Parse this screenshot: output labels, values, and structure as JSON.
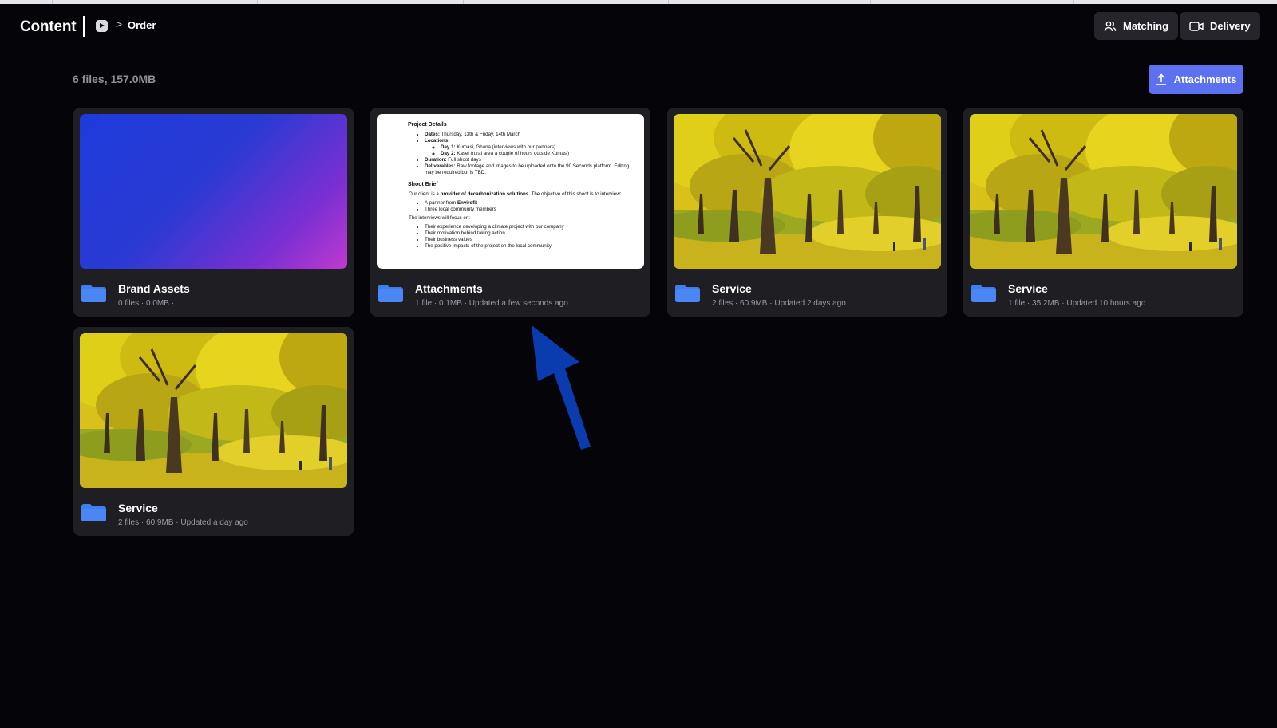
{
  "app": {
    "title": "Content"
  },
  "breadcrumb": {
    "icon": "play-badge-icon",
    "separator": ">",
    "current": "Order"
  },
  "header_buttons": [
    {
      "label": "Matching",
      "icon": "people-icon"
    },
    {
      "label": "Delivery",
      "icon": "camera-icon"
    }
  ],
  "summary": "6 files, 157.0MB",
  "upload_button": {
    "label": "Attachments",
    "icon": "upload-icon"
  },
  "cards": [
    {
      "title": "Brand Assets",
      "meta": "0 files · 0.0MB ·",
      "thumb": "gradient"
    },
    {
      "title": "Attachments",
      "meta": "1 file · 0.1MB · Updated a few seconds ago",
      "thumb": "document"
    },
    {
      "title": "Service",
      "meta": "2 files · 60.9MB · Updated 2 days ago",
      "thumb": "autumn-trees"
    },
    {
      "title": "Service",
      "meta": "1 file · 35.2MB · Updated 10 hours ago",
      "thumb": "autumn-trees"
    },
    {
      "title": "Service",
      "meta": "2 files · 60.9MB · Updated a day ago",
      "thumb": "autumn-trees"
    }
  ],
  "document_preview": {
    "heading1": "Project Details",
    "dates_label": "Dates:",
    "dates": "Thursday, 13th & Friday, 14th March",
    "locations_label": "Locations:",
    "day1_label": "Day 1:",
    "day1": "Kumasi, Ghana (interviews with our partners)",
    "day2_label": "Day 2:",
    "day2": "Kasei (rural area a couple of hours outside Kumasi)",
    "duration_label": "Duration:",
    "duration": "Full shoot days",
    "deliverables_label": "Deliverables:",
    "deliverables": "Raw footage and images to be uploaded onto the 90 Seconds platform. Editing may be required but is TBD.",
    "heading2": "Shoot Brief",
    "brief_a": "Our client is a ",
    "brief_bold": "provider of decarbonization solutions",
    "brief_b": ". The objective of this shoot is to interview:",
    "partner_a": "A partner from ",
    "partner_bold": "Envirofit",
    "members": "Three local community members",
    "focus": "The interviews will focus on:",
    "focus_items": [
      "Their experience developing a climate project with our company",
      "Their motivation behind taking action",
      "Their business values",
      "The positive impacts of the project on the local community"
    ]
  },
  "colors": {
    "accent": "#5b71f0",
    "folder": "#3f7ef0",
    "annotation_arrow": "#0a3cb0"
  }
}
